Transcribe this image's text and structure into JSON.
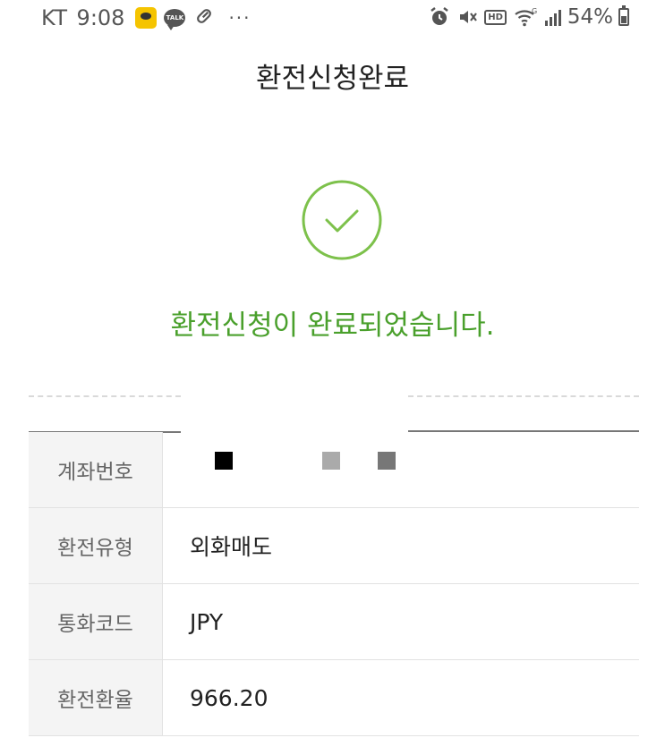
{
  "status_bar": {
    "carrier": "KT",
    "time": "9:08",
    "talk_label": "TALK",
    "more": "···",
    "hd_label": "HD",
    "battery_percent": "54%"
  },
  "header": {
    "title": "환전신청완료"
  },
  "success": {
    "message": "환전신청이 완료되었습니다.",
    "accent_color": "#4aa02c",
    "check_color": "#7dc14b"
  },
  "details": {
    "rows": [
      {
        "label": "계좌번호",
        "value": ""
      },
      {
        "label": "환전유형",
        "value": "외화매도"
      },
      {
        "label": "통화코드",
        "value": "JPY"
      },
      {
        "label": "환전환율",
        "value": "966.20"
      }
    ]
  }
}
